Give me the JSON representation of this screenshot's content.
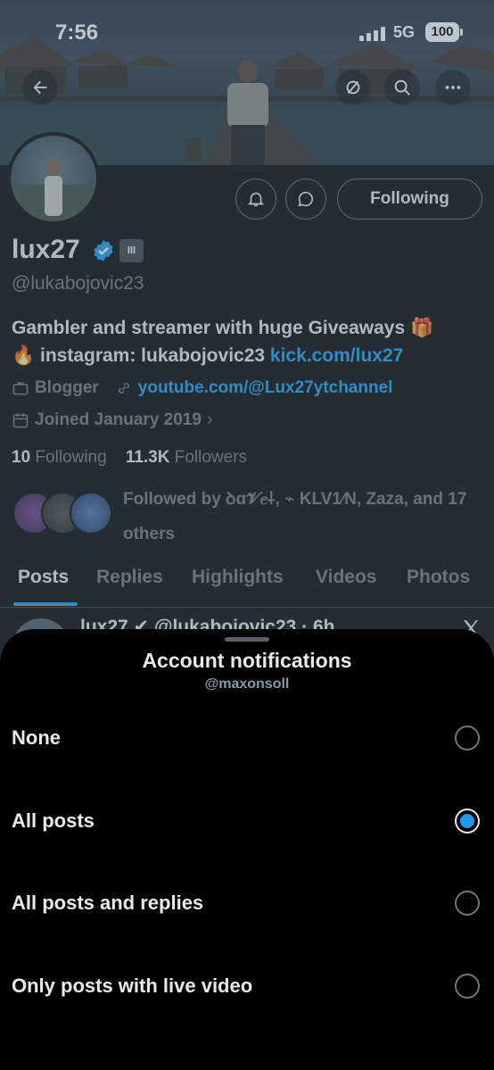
{
  "status_bar": {
    "time": "7:56",
    "network": "5G",
    "battery": "100"
  },
  "profile": {
    "display_name": "lux27",
    "handle": "@lukabojovic23",
    "bio_line1": "Gambler and streamer with huge Giveaways 🎁",
    "bio_line2_prefix": "🔥 instagram: lukabojovic23 ",
    "bio_link": "kick.com/lux27",
    "category": "Blogger",
    "website": "youtube.com/@Lux27ytchannel",
    "joined": "Joined January 2019",
    "following_count": "10",
    "following_label": "Following",
    "followers_count": "11.3K",
    "followers_label": "Followers",
    "followed_by": "Followed by ꝺɑ𝓥𝑒⸸, ⌁ KLV1⁄N, Zaza, and 17 others",
    "following_button": "Following",
    "affiliate_badge": "lll"
  },
  "tabs": [
    "Posts",
    "Replies",
    "Highlights",
    "Videos",
    "Photos"
  ],
  "post_peek": {
    "text": "lux27 ✔ @lukabojovic23 · 6h"
  },
  "sheet": {
    "title": "Account notifications",
    "subtitle": "@maxonsoll",
    "options": [
      {
        "label": "None",
        "selected": false
      },
      {
        "label": "All posts",
        "selected": true
      },
      {
        "label": "All posts and replies",
        "selected": false
      },
      {
        "label": "Only posts with live video",
        "selected": false
      }
    ]
  },
  "colors": {
    "accent": "#1d9bf0",
    "background": "#000000",
    "secondary_text": "#71767b"
  }
}
